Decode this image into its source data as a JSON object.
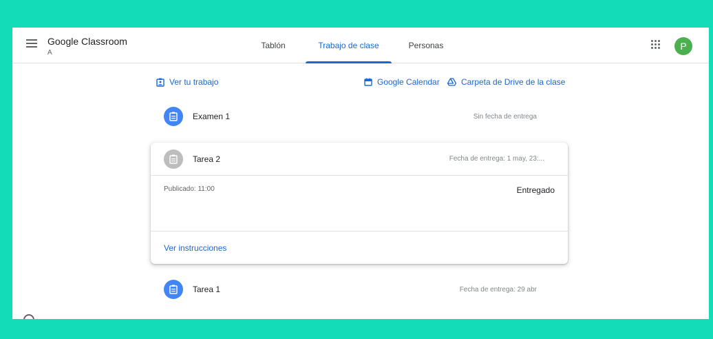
{
  "header": {
    "title": "Google Classroom",
    "subtitle": "A",
    "tabs": [
      {
        "label": "Tablón",
        "active": false
      },
      {
        "label": "Trabajo de clase",
        "active": true
      },
      {
        "label": "Personas",
        "active": false
      }
    ],
    "avatar_initial": "P",
    "avatar_color": "#4caf50"
  },
  "links": {
    "view_work": "Ver tu trabajo",
    "calendar": "Google Calendar",
    "drive": "Carpeta de Drive de la clase"
  },
  "assignments": [
    {
      "title": "Examen 1",
      "due": "Sin fecha de entrega",
      "state": "active"
    },
    {
      "title": "Tarea 2",
      "due": "Fecha de entrega: 1 may, 23:...",
      "state": "submitted",
      "published": "Publicado: 11:00",
      "status": "Entregado",
      "instructions_link": "Ver instrucciones"
    },
    {
      "title": "Tarea 1",
      "due": "Fecha de entrega: 29 abr",
      "state": "active"
    }
  ],
  "colors": {
    "accent": "#1967d2",
    "assignment_icon_active": "#4285f4",
    "assignment_icon_submitted": "#bdbdbd",
    "page_background": "#13dcb9"
  }
}
